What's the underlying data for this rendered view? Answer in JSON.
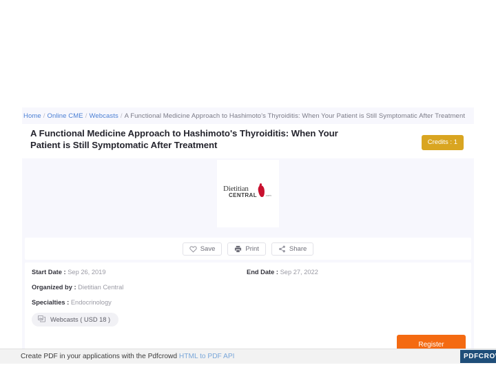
{
  "breadcrumb": {
    "items": [
      {
        "label": "Home",
        "type": "link"
      },
      {
        "label": "Online CME",
        "type": "link"
      },
      {
        "label": "Webcasts",
        "type": "link"
      },
      {
        "label": "A Functional Medicine Approach to Hashimoto's Thyroiditis: When Your Patient is Still Symptomatic After Treatment",
        "type": "current"
      }
    ],
    "separator": "/"
  },
  "header": {
    "title": "A Functional Medicine Approach to Hashimoto's Thyroiditis: When Your Patient is Still Symptomatic After Treatment",
    "credits_badge": "Credits : 1",
    "credits_badge_color": "#d9a521"
  },
  "hero": {
    "logo": {
      "name": "dietitian-central-logo",
      "line1": "Dietitian",
      "line2": "CENTRAL",
      "tld": ".com",
      "mark_color": "#c8102e"
    }
  },
  "actions": {
    "save_label": "Save",
    "print_label": "Print",
    "share_label": "Share"
  },
  "details": {
    "start_date_label": "Start Date :",
    "start_date_value": "Sep 26, 2019",
    "end_date_label": "End Date :",
    "end_date_value": "Sep 27, 2022",
    "organized_by_label": "Organized by :",
    "organized_by_value": "Dietitian Central",
    "specialties_label": "Specialties :",
    "specialties_value": "Endocrinology",
    "type_pill": "Webcasts ( USD 18 )",
    "register_label": "Register",
    "register_color": "#f46a11"
  },
  "footer": {
    "text_before_link": "Create PDF in your applications with the Pdfcrowd ",
    "link_label": "HTML to PDF API",
    "badge": "PDFCROWD"
  }
}
